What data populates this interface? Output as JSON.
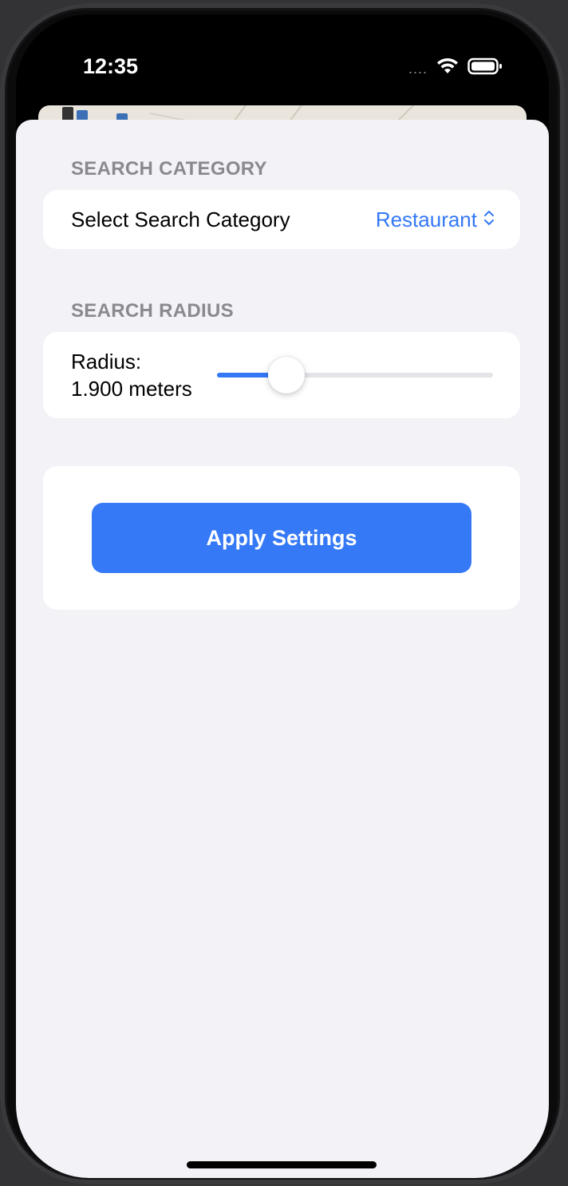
{
  "status_bar": {
    "time": "12:35",
    "signal": "....",
    "wifi_icon": "wifi-icon",
    "battery_icon": "battery-icon"
  },
  "category_section": {
    "header": "SEARCH CATEGORY",
    "row_label": "Select Search Category",
    "selected_value": "Restaurant",
    "picker_icon": "chevron-up-down-icon"
  },
  "radius_section": {
    "header": "SEARCH RADIUS",
    "label_title": "Radius:",
    "label_value": "1.900 meters",
    "slider_fraction": 0.25
  },
  "apply_section": {
    "button_label": "Apply Settings"
  },
  "colors": {
    "accent": "#3478f6",
    "sheet_background": "#f2f2f7",
    "card_background": "#ffffff",
    "section_header": "#8a8a8e"
  }
}
